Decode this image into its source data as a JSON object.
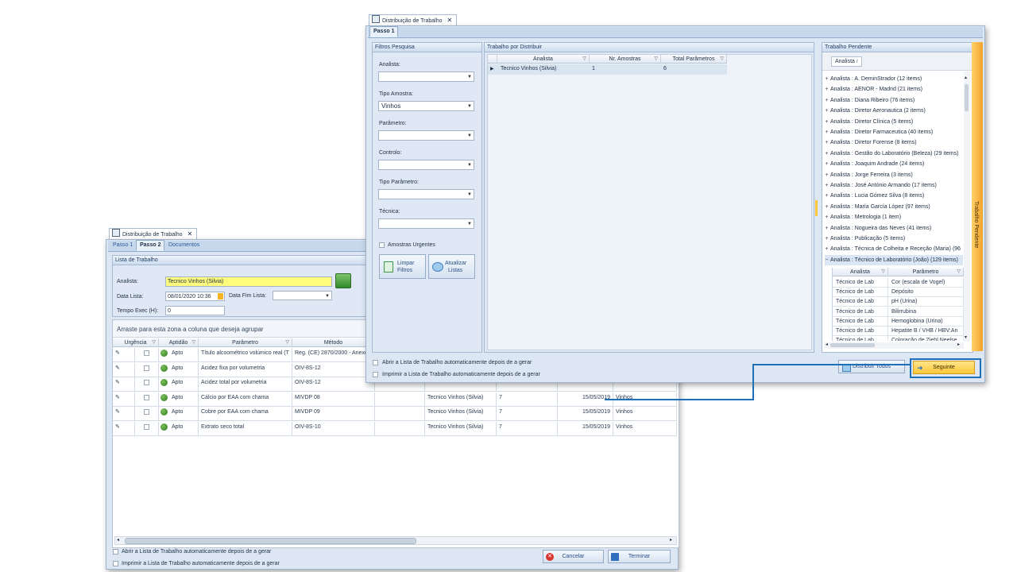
{
  "back_window": {
    "tab_title": "Distribuição de Trabalho",
    "steps": [
      "Passo 1",
      "Passo 2",
      "Documentos"
    ],
    "panel_title": "Lista de Trabalho",
    "analista_label": "Analista:",
    "analista_value": "Tecnico Vinhos (Silvia)",
    "data_lista_label": "Data Lista:",
    "data_lista_value": "08/01/2020 10:36",
    "data_fim_label": "Data Fim Lista:",
    "tempo_exec_label": "Tempo Exec (H):",
    "tempo_exec_value": "0",
    "group_hint": "Arraste para esta zona a coluna que deseja agrupar",
    "columns": [
      "Urgência",
      "Aptidão",
      "Parâmetro",
      "Método"
    ],
    "rows": [
      {
        "aptidao": "Apto",
        "parametro": "Título alcoométrico volúmico real (T",
        "metodo": "Reg. (CE) 2870/2000 - Anexo",
        "analista": "",
        "n": "",
        "date": "",
        "tipo": ""
      },
      {
        "aptidao": "Apto",
        "parametro": "Acidez fixa por volumetria",
        "metodo": "OIV-8S-12",
        "analista": "",
        "n": "",
        "date": "",
        "tipo": ""
      },
      {
        "aptidao": "Apto",
        "parametro": "Acidez total por volumetria",
        "metodo": "OIV-8S-12",
        "analista": "",
        "n": "",
        "date": "",
        "tipo": ""
      },
      {
        "aptidao": "Apto",
        "parametro": "Cálcio por EAA com chama",
        "metodo": "MIVDP 08",
        "analista": "Tecnico Vinhos (Silvia)",
        "n": "7",
        "date": "15/05/2019",
        "tipo": "Vinhos"
      },
      {
        "aptidao": "Apto",
        "parametro": "Cobre por EAA com chama",
        "metodo": "MIVDP 09",
        "analista": "Tecnico Vinhos (Silvia)",
        "n": "7",
        "date": "15/05/2019",
        "tipo": "Vinhos"
      },
      {
        "aptidao": "Apto",
        "parametro": "Extrato seco total",
        "metodo": "OIV-8S-10",
        "analista": "Tecnico Vinhos (Silvia)",
        "n": "7",
        "date": "15/05/2019",
        "tipo": "Vinhos"
      }
    ],
    "check_open": "Abrir a Lista de Trabalho automaticamente depois de a gerar",
    "check_print": "Imprimir a Lista de Trabalho automaticamente depois de a gerar",
    "cancel_label": "Cancelar",
    "finish_label": "Terminar"
  },
  "front_window": {
    "tab_title": "Distribuição de Trabalho",
    "step": "Passo 1",
    "filters_title": "Filtros Pesquisa",
    "analista_label": "Analista:",
    "tipo_amostra_label": "Tipo Amostra:",
    "tipo_amostra_value": "Vinhos",
    "parametro_label": "Parâmetro:",
    "controlo_label": "Controlo:",
    "tipo_parametro_label": "Tipo Parâmetro:",
    "tecnica_label": "Técnica:",
    "urgent_label": "Amostras Urgentes",
    "clear_label_1": "Limpar",
    "clear_label_2": "Filtros",
    "refresh_label_1": "Atualizar",
    "refresh_label_2": "Listas",
    "distribute_title": "Trabalho por Distribuir",
    "dist_columns": [
      "Analista",
      "Nr. Amostras",
      "Total Parâmetros"
    ],
    "dist_row": {
      "analista": "Tecnico Vinhos (Silvia)",
      "amostras": "1",
      "parametros": "6"
    },
    "pending_title": "Trabalho Pendente",
    "pending_group_chip": "Analista",
    "pending_side_label": "Trabalho Pendente",
    "pending_items": [
      "Analista : A. DeminStrador (12 items)",
      "Analista : AENOR - Madrid (21 items)",
      "Analista : Diana Ribeiro (76 items)",
      "Analista : Diretor Aeronautica (2 items)",
      "Analista : Diretor Clínica (5 items)",
      "Analista : Diretor Farmaceutica (40 items)",
      "Analista : Diretor Forense (8 items)",
      "Analista : Gestão do Laboratório (Beleza) (29 items)",
      "Analista : Joaquim Andrade (24 items)",
      "Analista : Jorge Ferreira (3 items)",
      "Analista : José António Armando (17 items)",
      "Analista : Lucia Gómez Silva (8 items)",
      "Analista : María García López (97 items)",
      "Analista : Metrologia (1 item)",
      "Analista : Nogueira das Neves (41 items)",
      "Analista : Publicação (5 items)",
      "Analista : Técnica de Colheita e Receção (Maria) (96",
      "Analista : Técnico de Laboratório (João) (129 items)"
    ],
    "sub_columns": [
      "Analista",
      "Parâmetro"
    ],
    "sub_rows": [
      {
        "analista": "Técnico de Lab",
        "parametro": "Cor (escala de Vogel)"
      },
      {
        "analista": "Técnico de Lab",
        "parametro": "Depósito"
      },
      {
        "analista": "Técnico de Lab",
        "parametro": "pH (Urina)"
      },
      {
        "analista": "Técnico de Lab",
        "parametro": "Bilirrubina"
      },
      {
        "analista": "Técnico de Lab",
        "parametro": "Hemoglobina (Urina)"
      },
      {
        "analista": "Técnico de Lab",
        "parametro": "Hepatite B / VHB / HBV:An"
      },
      {
        "analista": "Técnico de Lab",
        "parametro": "Coloração de Ziehl Neelse"
      }
    ],
    "check_open": "Abrir a Lista de Trabalho automaticamente depois de a gerar",
    "check_print": "Imprimir a Lista de Trabalho automaticamente depois de a gerar",
    "distribute_all_label": "Distribuir Todos",
    "next_label": "Seguinte"
  },
  "colors": {
    "highlight": "#1f6fb8",
    "analista_field": "#fffb7d",
    "next_button": "#ffd34d"
  }
}
